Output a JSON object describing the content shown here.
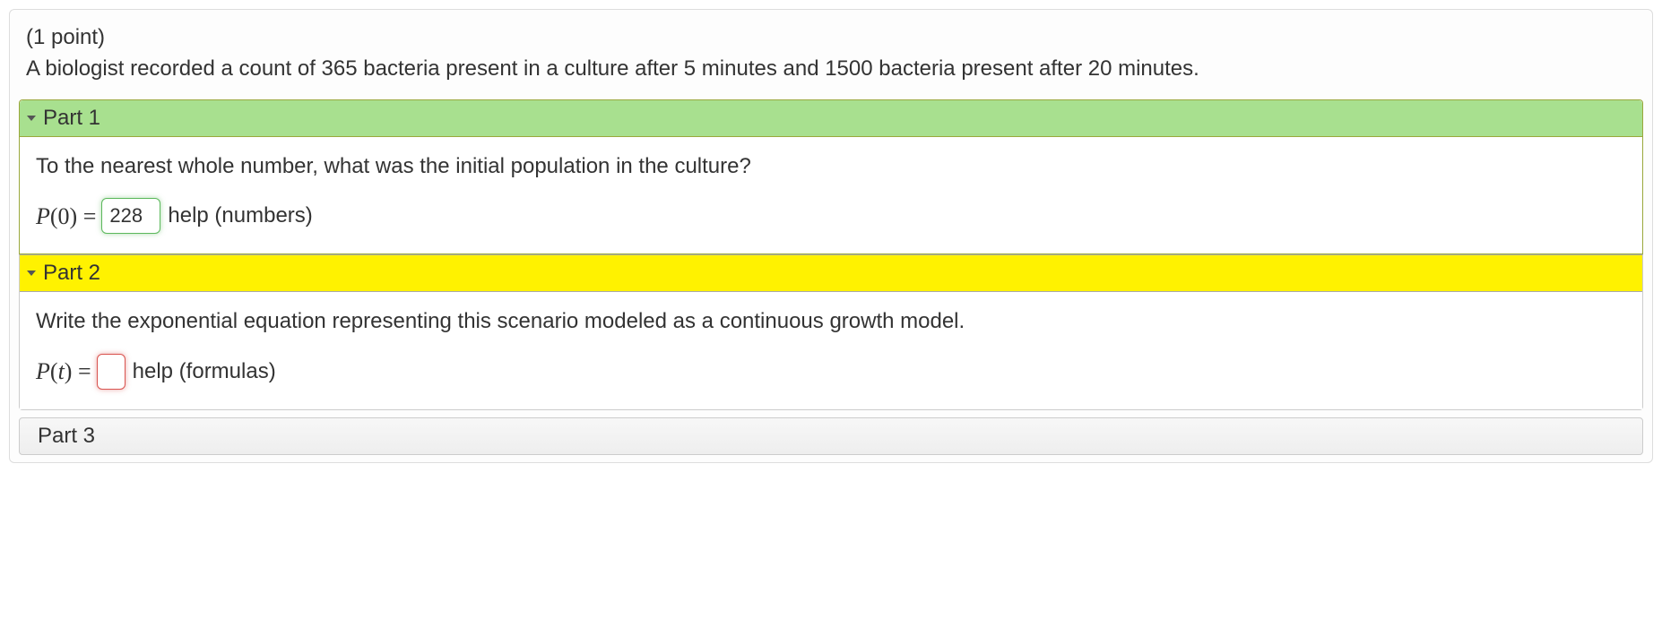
{
  "points_label": "(1 point)",
  "prompt_text": "A biologist recorded a count of 365 bacteria present in a culture after 5 minutes and 1500 bacteria present after 20 minutes.",
  "part1": {
    "title": "Part 1",
    "question": "To the nearest whole number, what was the initial population in the culture?",
    "lhs_var": "P",
    "lhs_arg": "(0)",
    "equals": " = ",
    "value": "228",
    "help_text": "help (numbers)"
  },
  "part2": {
    "title": "Part 2",
    "question": "Write the exponential equation representing this scenario modeled as a continuous growth model.",
    "lhs_var": "P",
    "lhs_arg": "(t)",
    "equals": " = ",
    "value": "",
    "help_text": "help (formulas)"
  },
  "part3": {
    "title": "Part 3"
  }
}
